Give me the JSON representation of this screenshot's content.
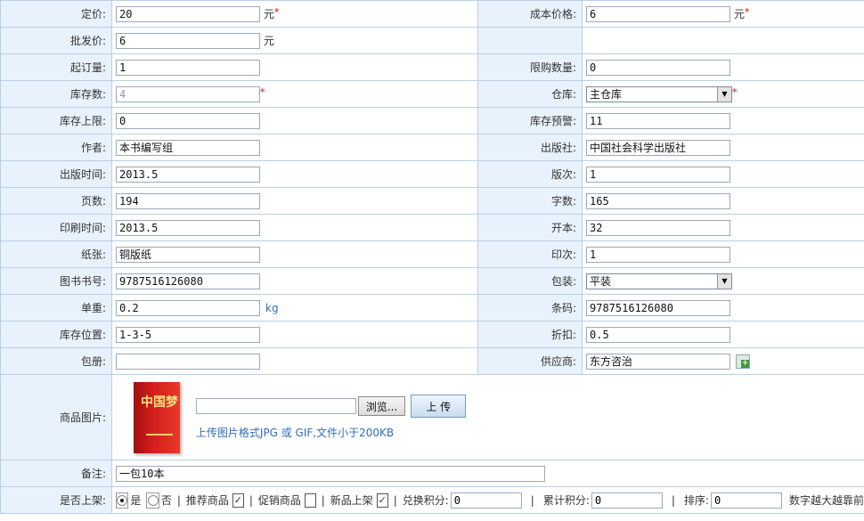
{
  "rows": [
    {
      "l1": "定价:",
      "v1": "20",
      "u1": "元",
      "r1": true,
      "l2": "成本价格:",
      "v2": "6",
      "u2": "元",
      "r2": true
    },
    {
      "l1": "批发价:",
      "v1": "6",
      "u1": "元",
      "r1": false,
      "l2": "",
      "v2": null
    },
    {
      "l1": "起订量:",
      "v1": "1",
      "l2": "限购数量:",
      "v2": "0"
    },
    {
      "l1": "库存数:",
      "v1": "4",
      "r1": true,
      "l2": "仓库:",
      "select2": "主仓库",
      "r2": true
    },
    {
      "l1": "库存上限:",
      "v1": "0",
      "l2": "库存预警:",
      "v2": "11"
    },
    {
      "l1": "作者:",
      "v1": "本书编写组",
      "l2": "出版社:",
      "v2": "中国社会科学出版社"
    },
    {
      "l1": "出版时间:",
      "v1": "2013.5",
      "l2": "版次:",
      "v2": "1"
    },
    {
      "l1": "页数:",
      "v1": "194",
      "l2": "字数:",
      "v2": "165"
    },
    {
      "l1": "印刷时间:",
      "v1": "2013.5",
      "l2": "开本:",
      "v2": "32"
    },
    {
      "l1": "纸张:",
      "v1": "铜版纸",
      "l2": "印次:",
      "v2": "1"
    },
    {
      "l1": "图书书号:",
      "v1": "9787516126080",
      "l2": "包装:",
      "select2": "平装"
    },
    {
      "l1": "单重:",
      "v1": "0.2",
      "kg": "kg",
      "l2": "条码:",
      "v2": "9787516126080"
    },
    {
      "l1": "库存位置:",
      "v1": "1-3-5",
      "l2": "折扣:",
      "v2": "0.5"
    },
    {
      "l1": "包册:",
      "v1": "",
      "l2": "供应商:",
      "v2": "东方咨治",
      "add": true
    }
  ],
  "image": {
    "label": "商品图片:",
    "book_title": "中国梦",
    "browse": "浏览...",
    "upload": "上 传",
    "hint": "上传图片格式JPG 或 GIF,文件小于200KB"
  },
  "note": {
    "label": "备注:",
    "value": "一包10本"
  },
  "listing": {
    "label": "是否上架:",
    "yes": "是",
    "no": "否",
    "recommend": "推荐商品",
    "promo": "促销商品",
    "new": "新品上架",
    "exchange": "兑换积分:",
    "exchange_val": "0",
    "accum": "累计积分:",
    "accum_val": "0",
    "sort": "排序:",
    "sort_val": "0",
    "sort_hint": "数字越大越靠前"
  },
  "colors": {
    "label_bg": "#e8f2fc",
    "border": "#b9d0e4",
    "required": "#e00000",
    "link": "#2f6dbd"
  }
}
